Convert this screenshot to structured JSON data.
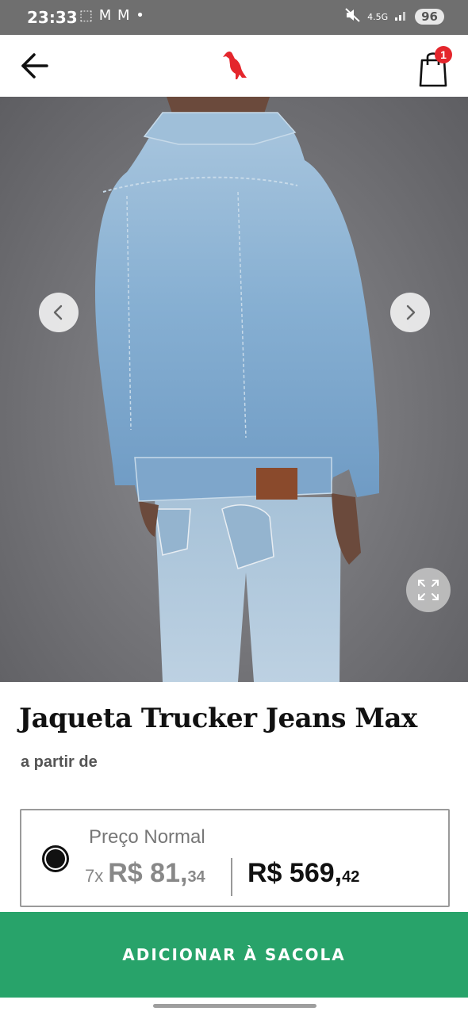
{
  "status_bar": {
    "time": "23:33",
    "notifications": "⬚ M M •",
    "network": "4.5G",
    "battery": "96"
  },
  "header": {
    "back_icon": "arrow-left-icon",
    "logo_icon": "reserva-pelican-logo",
    "bag_icon": "shopping-bag-icon",
    "bag_count": "1",
    "brand_color": "#e4262c"
  },
  "product": {
    "title": "Jaqueta Trucker Jeans Max",
    "price_prefix": "a partir de",
    "gallery": {
      "prev_icon": "chevron-left-icon",
      "next_icon": "chevron-right-icon",
      "expand_icon": "expand-icon"
    },
    "price_option": {
      "selected": true,
      "label": "Preço Normal",
      "installment_count": "7x",
      "installment_value": "R$ 81,",
      "installment_cents": "34",
      "total_value": "R$ 569,",
      "total_cents": "42"
    }
  },
  "cta": {
    "add_to_bag_label": "ADICIONAR À SACOLA",
    "color": "#28a36a"
  }
}
